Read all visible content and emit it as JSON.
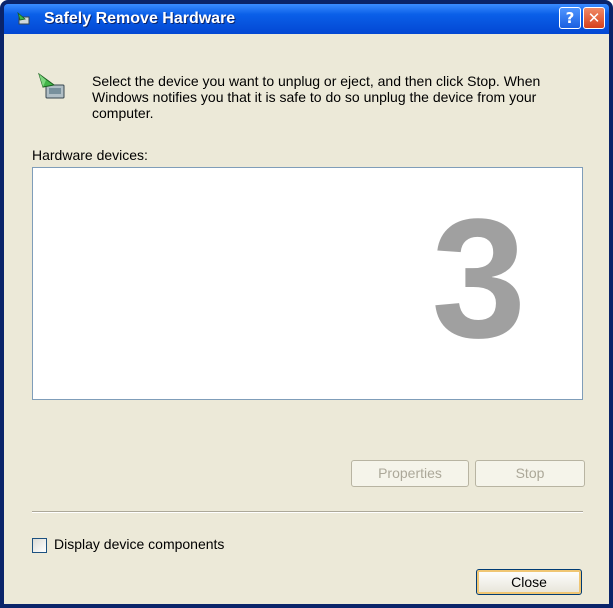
{
  "window": {
    "title": "Safely Remove Hardware",
    "help_glyph": "?",
    "close_glyph": "✕"
  },
  "instructions": "Select the device you want to unplug or eject, and then click Stop. When Windows notifies you that it is safe to do so unplug the device from your computer.",
  "hardware_label": "Hardware devices:",
  "device_list": [],
  "overlay_number": "3",
  "buttons": {
    "properties": "Properties",
    "stop": "Stop",
    "close": "Close"
  },
  "checkbox": {
    "label": "Display device components",
    "checked": false
  },
  "icons": [
    "safely-remove-hardware-icon",
    "help-icon",
    "close-icon",
    "device-eject-icon",
    "checkbox-icon"
  ],
  "colors": {
    "titlebar": "#0a5fe8",
    "window_face": "#ece9d8",
    "disabled_text": "#aca899",
    "overlay_number": "#a0a0a0"
  }
}
